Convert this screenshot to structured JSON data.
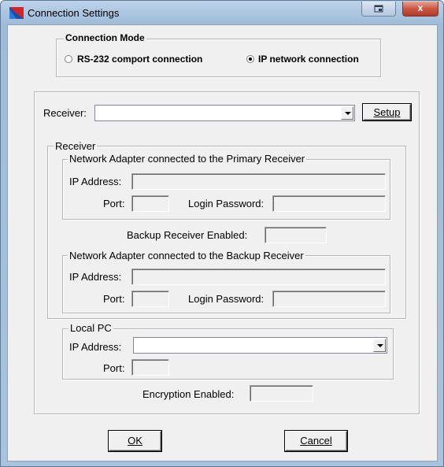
{
  "window": {
    "title": "Connection Settings",
    "close_label": "x"
  },
  "connection_mode": {
    "legend": "Connection Mode",
    "options": [
      {
        "label": "RS-232 comport connection",
        "selected": false
      },
      {
        "label": "IP network connection",
        "selected": true
      }
    ]
  },
  "receiver_select": {
    "label": "Receiver:",
    "value": "",
    "setup_label": "Setup"
  },
  "receiver_group": {
    "legend": "Receiver",
    "primary": {
      "legend": "Network Adapter connected to the Primary Receiver",
      "ip_label": "IP Address:",
      "ip_value": "",
      "port_label": "Port:",
      "port_value": "",
      "password_label": "Login Password:",
      "password_value": ""
    },
    "backup_enabled": {
      "label": "Backup Receiver Enabled:",
      "value": ""
    },
    "backup": {
      "legend": "Network Adapter connected to the Backup Receiver",
      "ip_label": "IP Address:",
      "ip_value": "",
      "port_label": "Port:",
      "port_value": "",
      "password_label": "Login Password:",
      "password_value": ""
    },
    "local_pc": {
      "legend": "Local PC",
      "ip_label": "IP Address:",
      "ip_value": "",
      "port_label": "Port:",
      "port_value": ""
    },
    "encryption": {
      "label": "Encryption Enabled:",
      "value": ""
    }
  },
  "buttons": {
    "ok": "OK",
    "cancel": "Cancel"
  },
  "colors": {
    "title_gradient_top": "#bcd3ea",
    "dialog_bg": "#f0f0f0",
    "close_button": "#c75844"
  }
}
